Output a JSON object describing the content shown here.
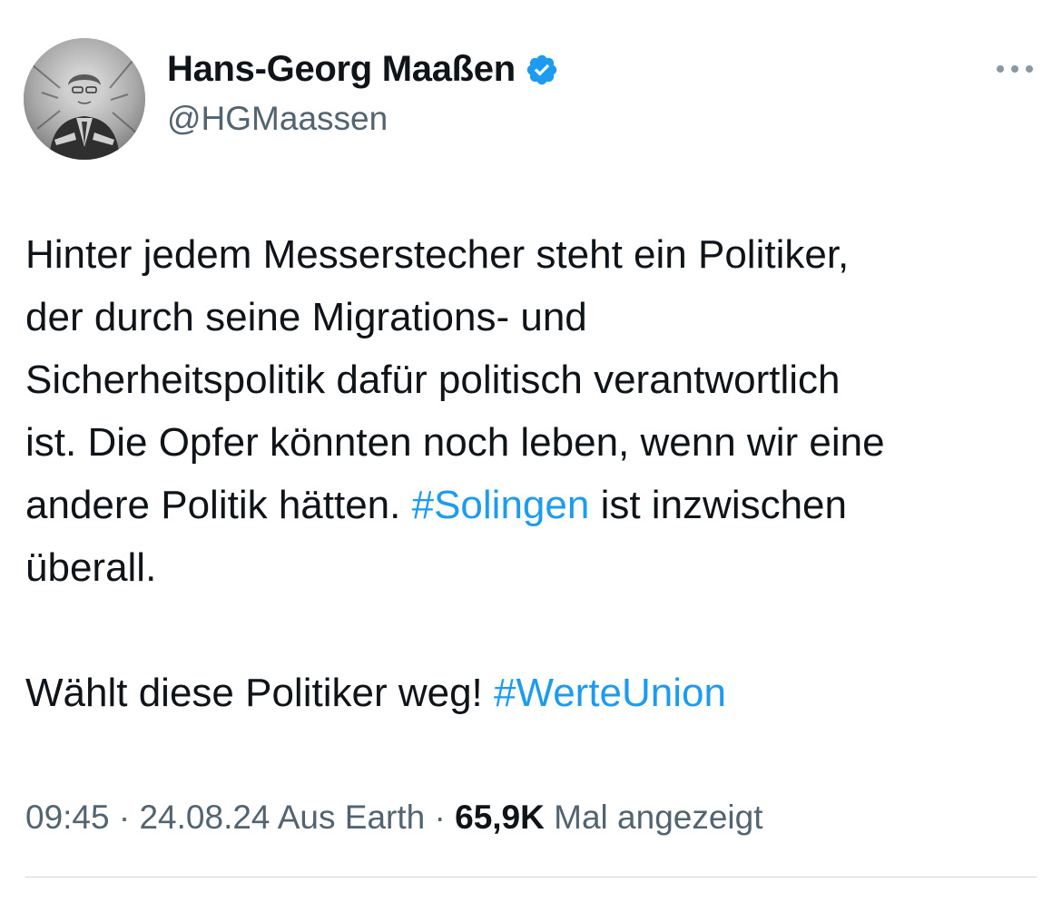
{
  "author": {
    "display_name": "Hans-Georg Maaßen",
    "handle": "@HGMaassen",
    "avatar_icon": "profile-photo-icon",
    "verified_icon": "verified-badge-icon",
    "verified_color": "#1d9bf0"
  },
  "header": {
    "more_icon": "more-horizontal-icon"
  },
  "tweet": {
    "lines": [
      "Hinter jedem Messerstecher steht ein Politiker,",
      "der durch seine Migrations- und",
      "Sicherheitspolitik dafür politisch verantwortlich",
      "ist. Die Opfer könnten noch leben, wenn wir eine"
    ],
    "line5_before": "andere Politik hätten. ",
    "hashtag_solingen": "#Solingen",
    "line5_after": " ist inzwischen",
    "line6": "überall.",
    "line7_before": "Wählt diese Politiker weg! ",
    "hashtag_werteunion": "#WerteUnion"
  },
  "meta": {
    "time": "09:45",
    "separator": " · ",
    "date": "24.08.24",
    "source": " Aus Earth",
    "views_count": "65,9K",
    "views_label": " Mal angezeigt"
  },
  "colors": {
    "text": "#0f1419",
    "secondary": "#536471",
    "link": "#1d9bf0",
    "divider": "#cfd9de"
  }
}
